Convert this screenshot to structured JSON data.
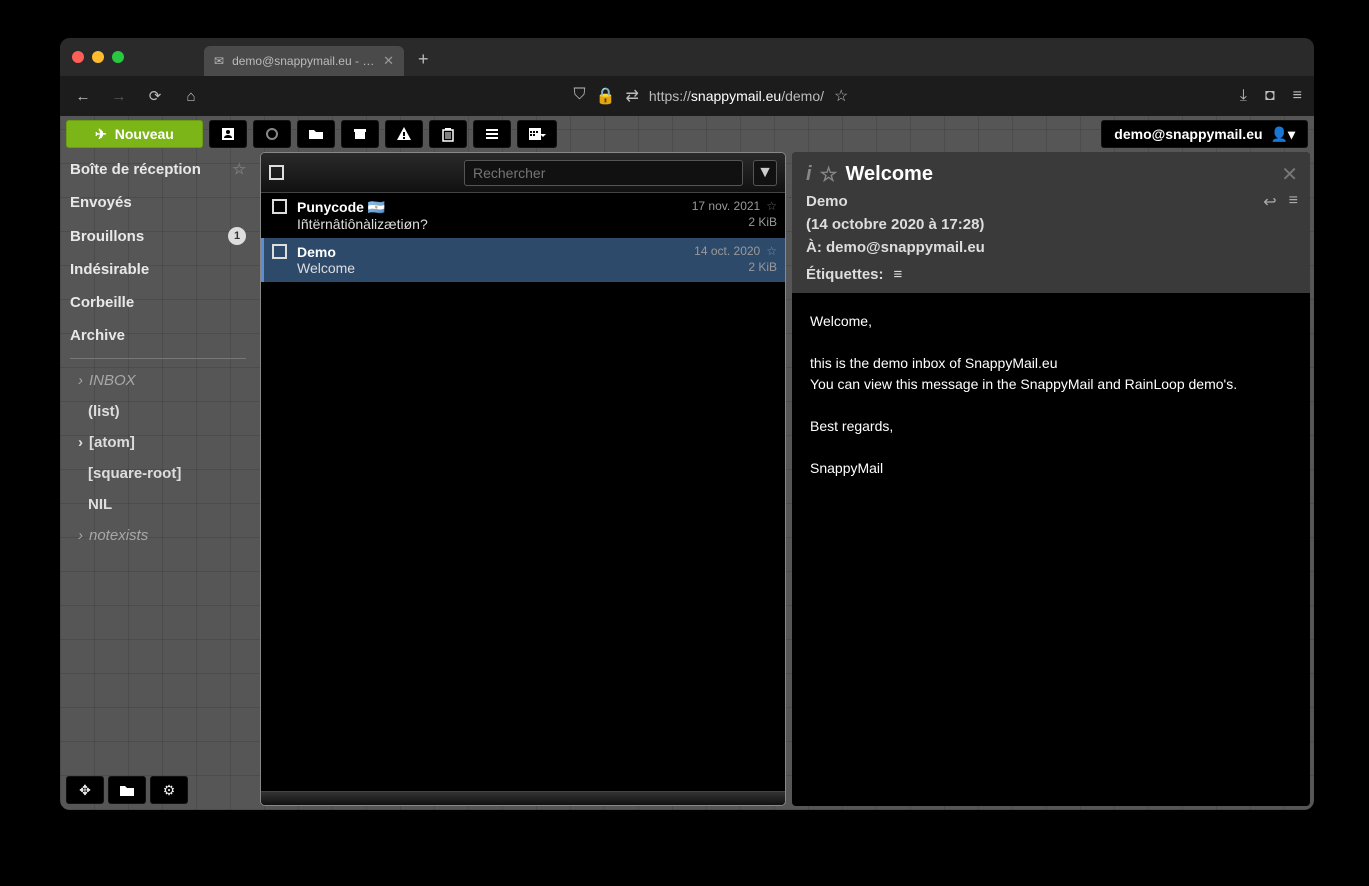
{
  "browser": {
    "tab_title": "demo@snappymail.eu - Boîte m...",
    "url_pre": "https://",
    "url_host": "snappymail.eu",
    "url_path": "/demo/"
  },
  "toolbar": {
    "compose_label": "Nouveau",
    "account": "demo@snappymail.eu"
  },
  "folders": {
    "inbox": "Boîte de réception",
    "sent": "Envoyés",
    "drafts": "Brouillons",
    "drafts_count": "1",
    "spam": "Indésirable",
    "trash": "Corbeille",
    "archive": "Archive",
    "sub_inbox": "INBOX",
    "sub_list": "(list)",
    "sub_atom": "[atom]",
    "sub_sqrt": "[square-root]",
    "sub_nil": "NIL",
    "sub_notexists": "notexists"
  },
  "list": {
    "search_placeholder": "Rechercher",
    "messages": [
      {
        "from": "Punycode 🇦🇷",
        "subject": "Iñtërnâtiônàlizætiøn?",
        "date": "17 nov. 2021",
        "size": "2 KiB"
      },
      {
        "from": "Demo",
        "subject": "Welcome",
        "date": "14 oct. 2020",
        "size": "2 KiB"
      }
    ]
  },
  "detail": {
    "subject": "Welcome",
    "from": "Demo",
    "date": "(14 octobre 2020 à 17:28)",
    "to_label": "À:",
    "to": "demo@snappymail.eu",
    "tags_label": "Étiquettes:",
    "body": "Welcome,\n\nthis is the demo inbox of SnappyMail.eu\nYou can view this message in the SnappyMail and RainLoop demo's.\n\nBest regards,\n\nSnappyMail"
  }
}
